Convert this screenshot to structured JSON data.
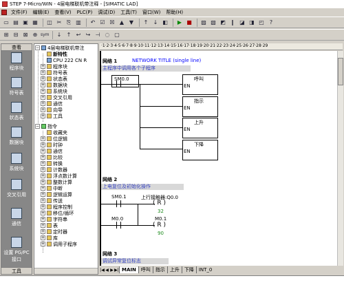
{
  "window": {
    "title": "STEP 7-Micro/WIN - 4层电梯联机带注释 - [SIMATIC LAD]"
  },
  "menu": [
    "文件(F)",
    "编辑(E)",
    "查看(V)",
    "PLC(P)",
    "调试(D)",
    "工具(T)",
    "窗口(W)",
    "帮助(H)"
  ],
  "nav": {
    "header": "查看",
    "footer": "工具",
    "items": [
      "程序块",
      "符号表",
      "状态表",
      "数据块",
      "系统块",
      "交叉引用",
      "通信",
      "设置 PG/PC 接口"
    ]
  },
  "tree": {
    "root": "4层电梯联机带注",
    "items": [
      "新特性",
      "CPU 222 CN R",
      "程序块",
      "符号表",
      "状态表",
      "数据块",
      "系统块",
      "交叉引用",
      "通信",
      "向导",
      "工具"
    ],
    "instr_root": "指令",
    "instr": [
      "收藏夹",
      "位逻辑",
      "时钟",
      "通信",
      "比较",
      "转换",
      "计数器",
      "浮点数计算",
      "整数计算",
      "中断",
      "逻辑运算",
      "传送",
      "程序控制",
      "移位/循环",
      "字符串",
      "表",
      "定时器",
      "库",
      "调用子程序"
    ]
  },
  "ruler": "·1·2·3·4·5·6·7·8·9·10·11·12·13·14·15·16·17·18·19·20·21·22·23·24·25·26·27·28·29",
  "networks": [
    {
      "label": "网络 1",
      "title": "NETWORK TITLE (single line)",
      "comment": "主程序中调用各个子程序",
      "contact": "SM0.0",
      "coils": [
        "呼叫",
        "指示",
        "上升",
        "下降"
      ],
      "en": "EN"
    },
    {
      "label": "网络 2",
      "comment": "上电复位及初始化操作",
      "c1": "SM0.1",
      "c2": "M0.0",
      "r1_name": "上行接触器:Q0.0",
      "r1_type": "R",
      "r1_val": "32",
      "r2_name": "M0.1",
      "r2_type": "R",
      "r2_val": "90"
    },
    {
      "label": "网络 3",
      "comment": "调试异常复位标志"
    }
  ],
  "tabs": [
    "MAIN",
    "呼叫",
    "指示",
    "上升",
    "下降",
    "INT_0"
  ]
}
